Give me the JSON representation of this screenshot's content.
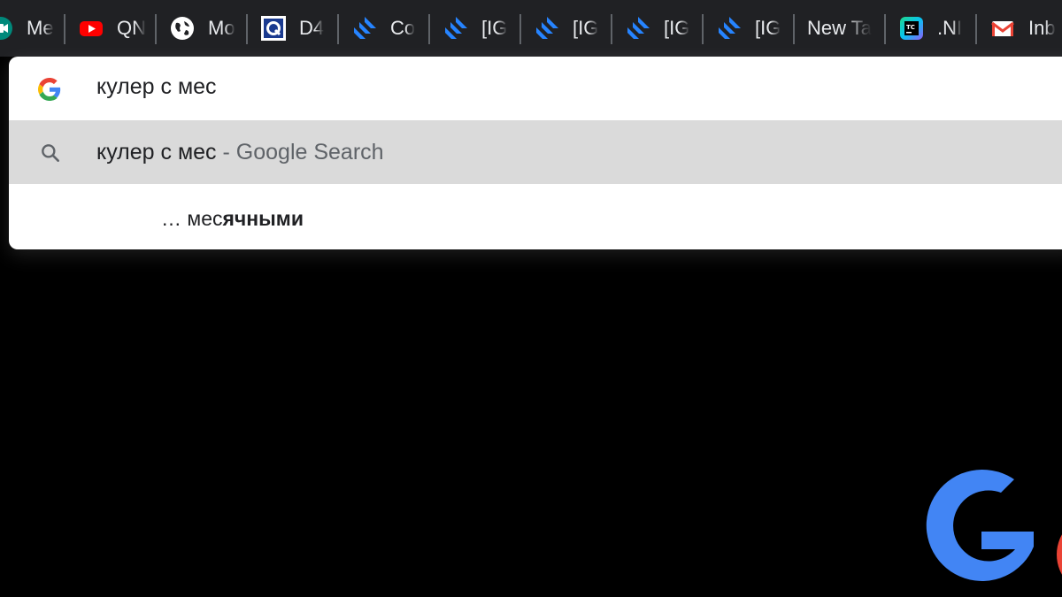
{
  "tabs": [
    {
      "title": "Me",
      "icon": "meet-icon"
    },
    {
      "title": "QN",
      "icon": "youtube-icon"
    },
    {
      "title": "Mo",
      "icon": "globe-icon"
    },
    {
      "title": "D4",
      "icon": "qnap-icon"
    },
    {
      "title": "Co",
      "icon": "jira-icon"
    },
    {
      "title": "[IG",
      "icon": "jira-icon"
    },
    {
      "title": "[IG",
      "icon": "jira-icon"
    },
    {
      "title": "[IG",
      "icon": "jira-icon"
    },
    {
      "title": "[IG",
      "icon": "jira-icon"
    },
    {
      "title": "New Ta",
      "icon": ""
    },
    {
      "title": ".NI",
      "icon": "teamcity-icon"
    },
    {
      "title": "Inb",
      "icon": "gmail-icon"
    }
  ],
  "omnibox": {
    "query": "кулер с мес"
  },
  "suggestion": {
    "query": "кулер с мес",
    "separator": "-",
    "provider": "Google Search"
  },
  "tail_suggestion": {
    "prefix": "… мес",
    "completion": "ячными"
  },
  "colors": {
    "tabstrip": "#202124",
    "page_background": "#000000",
    "google_blue": "#4285F4",
    "google_red": "#EA4335",
    "google_yellow": "#FBBC05",
    "google_green": "#34A853",
    "jira_blue": "#2684FF"
  }
}
